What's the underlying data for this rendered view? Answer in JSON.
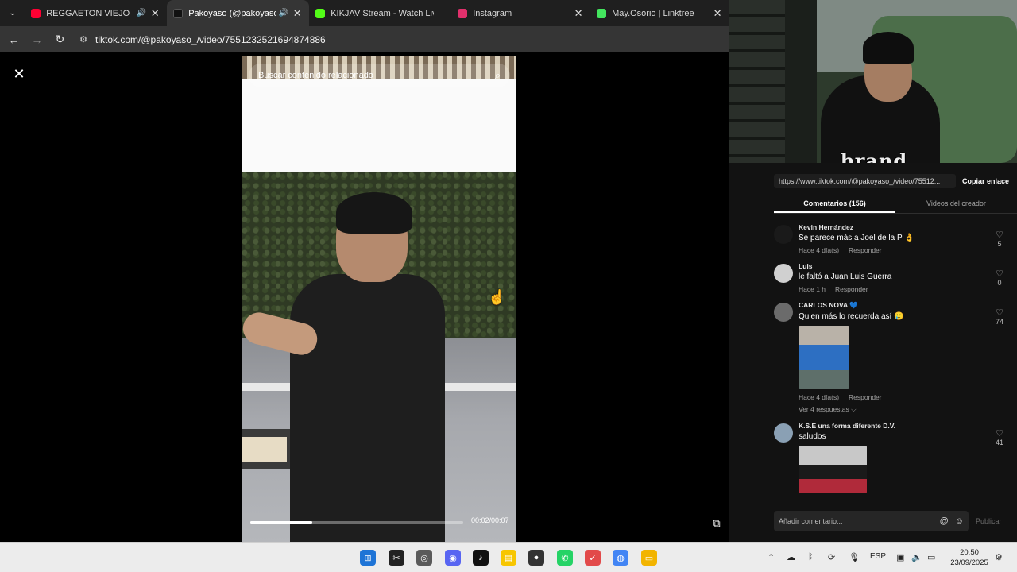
{
  "browser": {
    "tabs": [
      {
        "title": "REGGAETON VIEJO MIX",
        "favicon_color": "#ff0033",
        "audio": true,
        "active": false
      },
      {
        "title": "Pakoyaso (@pakoyaso_",
        "favicon_color": "#111111",
        "audio": true,
        "active": true
      },
      {
        "title": "KIKJAV Stream - Watch Live",
        "favicon_color": "#53fc18",
        "audio": false,
        "active": false
      },
      {
        "title": "Instagram",
        "favicon_color": "#e1306c",
        "audio": false,
        "active": false
      },
      {
        "title": "May.Osorio | Linktree",
        "favicon_color": "#43e55e",
        "audio": false,
        "active": false
      }
    ],
    "url": "tiktok.com/@pakoyaso_/video/7551232521694874886"
  },
  "video": {
    "search_placeholder": "Buscar contenido relacionado",
    "time": "00:02/00:07",
    "progress": 0.29
  },
  "webcam": {
    "overlay_logo": "brand"
  },
  "panel": {
    "share_link": "https://www.tiktok.com/@pakoyaso_/video/75512...",
    "copy_label": "Copiar enlace",
    "tabs": [
      {
        "label": "Comentarios (156)",
        "active": true
      },
      {
        "label": "Videos del creador",
        "active": false
      }
    ],
    "comments": [
      {
        "user": "Kevin Hernández",
        "text": "Se parece más a Joel de la P 👌",
        "time": "Hace 4 día(s)",
        "reply": "Responder",
        "likes": "5",
        "avatar_color": "#1a1a1a"
      },
      {
        "user": "Luis",
        "text": "le faltó a Juan Luis Guerra",
        "time": "Hace 1 h",
        "reply": "Responder",
        "likes": "0",
        "avatar_color": "#d0d0d0"
      },
      {
        "user": "CARLOS NOVA 💙",
        "text": "Quien más lo recuerda así 🥲",
        "time": "Hace 4 día(s)",
        "reply": "Responder",
        "likes": "74",
        "avatar_color": "#6b6b6b",
        "replies": "Ver 4 respuestas ⌵"
      },
      {
        "user": "K.S.E una forma diferente D.V.",
        "text": "saludos",
        "likes": "41",
        "avatar_color": "#8aa0b4"
      }
    ],
    "input_placeholder": "Añadir comentario...",
    "publish_label": "Publicar"
  },
  "taskbar": {
    "lang": "ESP",
    "time": "20:50",
    "date": "23/09/2025"
  }
}
